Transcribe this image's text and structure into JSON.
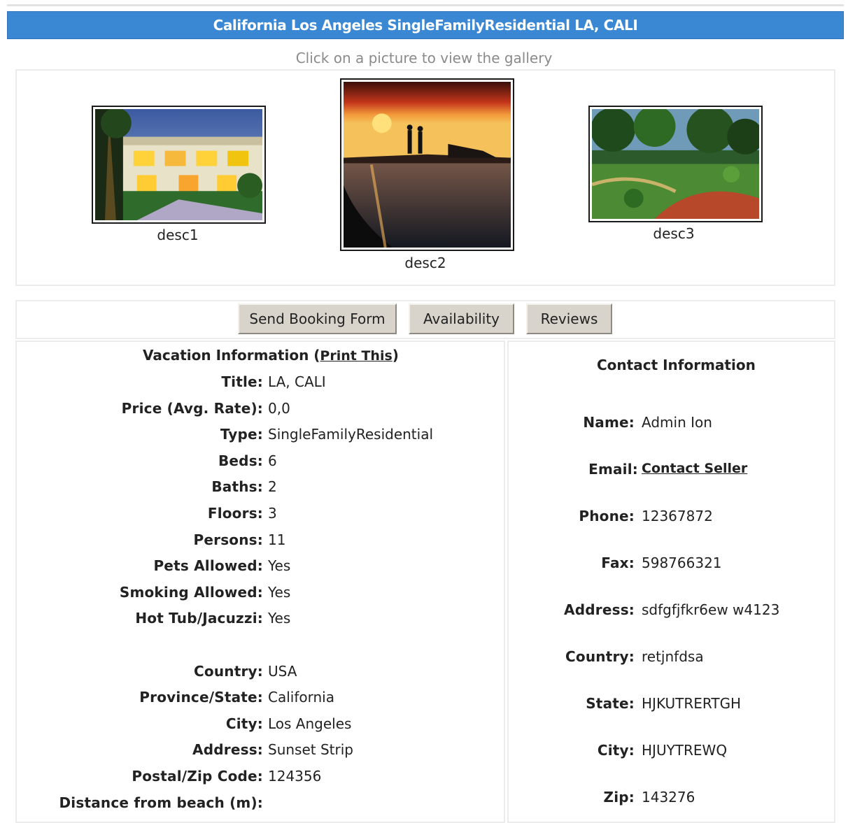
{
  "header": {
    "title": "California Los Angeles SingleFamilyResidential LA, CALI",
    "gallery_hint": "Click on a picture to view the gallery"
  },
  "gallery": [
    {
      "caption": "desc1",
      "scene": "resort-villa-night"
    },
    {
      "caption": "desc2",
      "scene": "beach-sunset-couple"
    },
    {
      "caption": "desc3",
      "scene": "tropical-garden"
    }
  ],
  "tabs": [
    "Send Booking Form",
    "Availability",
    "Reviews"
  ],
  "vacation": {
    "heading": "Vacation Information",
    "print_link": "Print This",
    "fields": [
      {
        "label": "Title",
        "value": "LA, CALI"
      },
      {
        "label": "Price (Avg. Rate)",
        "value": "0,0"
      },
      {
        "label": "Type",
        "value": "SingleFamilyResidential"
      },
      {
        "label": "Beds",
        "value": "6"
      },
      {
        "label": "Baths",
        "value": "2"
      },
      {
        "label": "Floors",
        "value": "3"
      },
      {
        "label": "Persons",
        "value": "11"
      },
      {
        "label": "Pets Allowed",
        "value": "Yes"
      },
      {
        "label": "Smoking Allowed",
        "value": "Yes"
      },
      {
        "label": "Hot Tub/Jacuzzi",
        "value": "Yes"
      }
    ],
    "location": [
      {
        "label": "Country",
        "value": "USA"
      },
      {
        "label": "Province/State",
        "value": "California"
      },
      {
        "label": "City",
        "value": "Los Angeles"
      },
      {
        "label": "Address",
        "value": "Sunset Strip"
      },
      {
        "label": "Postal/Zip Code",
        "value": "124356"
      },
      {
        "label": "Distance from beach (m)",
        "value": ""
      }
    ]
  },
  "contact": {
    "heading": "Contact Information",
    "name_label": "Name",
    "name": "Admin Ion",
    "email_label": "Email",
    "email_link": "Contact Seller",
    "phone_label": "Phone",
    "phone": "12367872",
    "fax_label": "Fax",
    "fax": "598766321",
    "address_label": "Address",
    "address": "sdfgfjfkr6ew w4123",
    "country_label": "Country",
    "country": "retjnfdsa",
    "state_label": "State",
    "state": "HJKUTRERTGH",
    "city_label": "City",
    "city": "HJUYTREWQ",
    "zip_label": "Zip",
    "zip": "143276"
  }
}
